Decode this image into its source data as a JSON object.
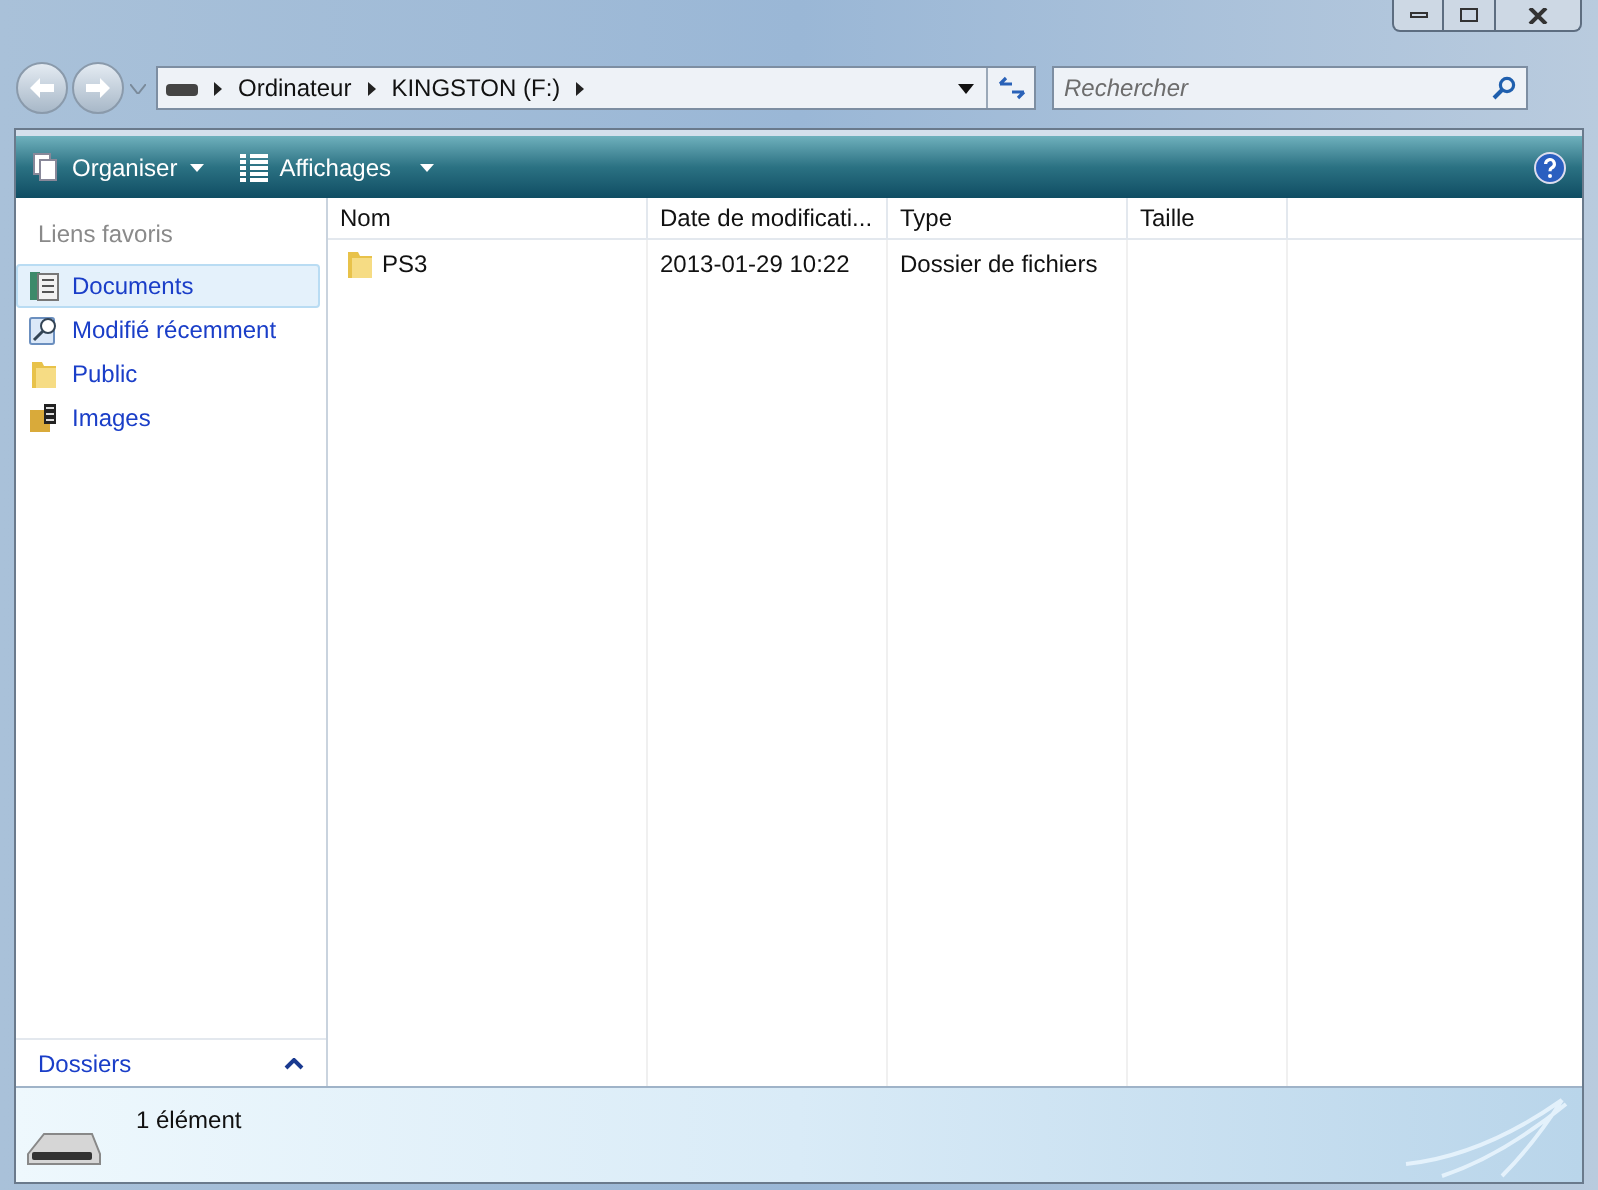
{
  "address": {
    "crumbs": [
      "Ordinateur",
      "KINGSTON (F:)"
    ]
  },
  "search": {
    "placeholder": "Rechercher"
  },
  "toolbar": [
    {
      "label": "Organiser",
      "kind": "organise"
    },
    {
      "label": "Affichages",
      "kind": "views"
    }
  ],
  "sidebar": {
    "heading": "Liens favoris",
    "items": [
      {
        "label": "Documents",
        "kind": "documents",
        "selected": true
      },
      {
        "label": "Modifié récemment",
        "kind": "recent",
        "selected": false
      },
      {
        "label": "Public",
        "kind": "folder",
        "selected": false
      },
      {
        "label": "Images",
        "kind": "images",
        "selected": false
      }
    ],
    "folders": {
      "label": "Dossiers",
      "expanded": true
    }
  },
  "table": {
    "columns": [
      "Nom",
      "Date de modificati...",
      "Type",
      "Taille"
    ],
    "rows": [
      {
        "name": "PS3",
        "date": "2013-01-29 10:22",
        "type": "Dossier de fichiers",
        "size_text": ""
      }
    ]
  },
  "status_bar": {
    "count": "1 élément"
  }
}
